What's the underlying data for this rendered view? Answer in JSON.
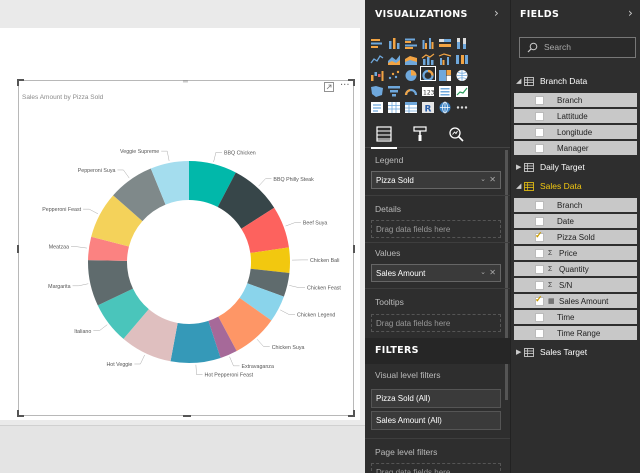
{
  "visual": {
    "title": "Sales Amount by Pizza Sold",
    "drag_handle": "═",
    "more_label": "···"
  },
  "chart_data": {
    "type": "pie",
    "donut": true,
    "title": "Sales Amount by Pizza Sold",
    "categories": [
      "BBQ Chicken",
      "BBQ Philly Steak",
      "Beef Suya",
      "Chicken Bali",
      "Chicken Feast",
      "Chicken Legend",
      "Chicken Suya",
      "Extravaganza",
      "Hot Pepperoni Feast",
      "Hot Veggie",
      "Italiano",
      "Margarita",
      "Meatzaa",
      "Pepperoni Feast",
      "Pepperoni Suya",
      "Veggie Supreme"
    ],
    "values": [
      7.2,
      7.8,
      6.3,
      3.8,
      3.6,
      4.0,
      6.9,
      2.6,
      7.5,
      7.8,
      6.3,
      6.9,
      3.5,
      7.0,
      6.9,
      5.8
    ],
    "colors": [
      "#01b8aa",
      "#374649",
      "#fd625e",
      "#f2c80f",
      "#5f6b6d",
      "#8ad4eb",
      "#fe9666",
      "#a66999",
      "#3599b8",
      "#dfbfbf",
      "#4ac5bb",
      "#5f6b6d",
      "#fb8281",
      "#f4d25a",
      "#7f898a",
      "#a4ddee"
    ]
  },
  "visualizations": {
    "header": "VISUALIZATIONS",
    "arrow": "›",
    "legend_label": "Legend",
    "legend_value": "Pizza Sold",
    "details_label": "Details",
    "details_placeholder": "Drag data fields here",
    "values_label": "Values",
    "values_value": "Sales Amount",
    "tooltips_label": "Tooltips",
    "tooltips_placeholder": "Drag data fields here",
    "remove_glyph": "✕",
    "dropdown_glyph": "⌄"
  },
  "filters": {
    "header": "FILTERS",
    "visual_level_label": "Visual level filters",
    "items": [
      "Pizza Sold  (All)",
      "Sales Amount  (All)"
    ],
    "page_level_label": "Page level filters",
    "page_placeholder": "Drag data fields here"
  },
  "fields": {
    "header": "FIELDS",
    "arrow": "›",
    "search_placeholder": "Search",
    "tables": [
      {
        "name": "Branch Data",
        "expanded": true,
        "active": false,
        "fields": [
          {
            "name": "Branch",
            "checked": false,
            "sigma": false
          },
          {
            "name": "Lattitude",
            "checked": false,
            "sigma": false
          },
          {
            "name": "Longitude",
            "checked": false,
            "sigma": false
          },
          {
            "name": "Manager",
            "checked": false,
            "sigma": false
          }
        ]
      },
      {
        "name": "Daily Target",
        "expanded": false,
        "active": false,
        "fields": []
      },
      {
        "name": "Sales Data",
        "expanded": true,
        "active": true,
        "fields": [
          {
            "name": "Branch",
            "checked": false,
            "sigma": false
          },
          {
            "name": "Date",
            "checked": false,
            "sigma": false
          },
          {
            "name": "Pizza Sold",
            "checked": true,
            "sigma": false
          },
          {
            "name": "Price",
            "checked": false,
            "sigma": true
          },
          {
            "name": "Quantity",
            "checked": false,
            "sigma": true
          },
          {
            "name": "S/N",
            "checked": false,
            "sigma": true
          },
          {
            "name": "Sales Amount",
            "checked": true,
            "sigma": false,
            "calc": true
          },
          {
            "name": "Time",
            "checked": false,
            "sigma": false
          },
          {
            "name": "Time Range",
            "checked": false,
            "sigma": false
          }
        ]
      },
      {
        "name": "Sales Target",
        "expanded": false,
        "active": false,
        "fields": []
      }
    ]
  }
}
